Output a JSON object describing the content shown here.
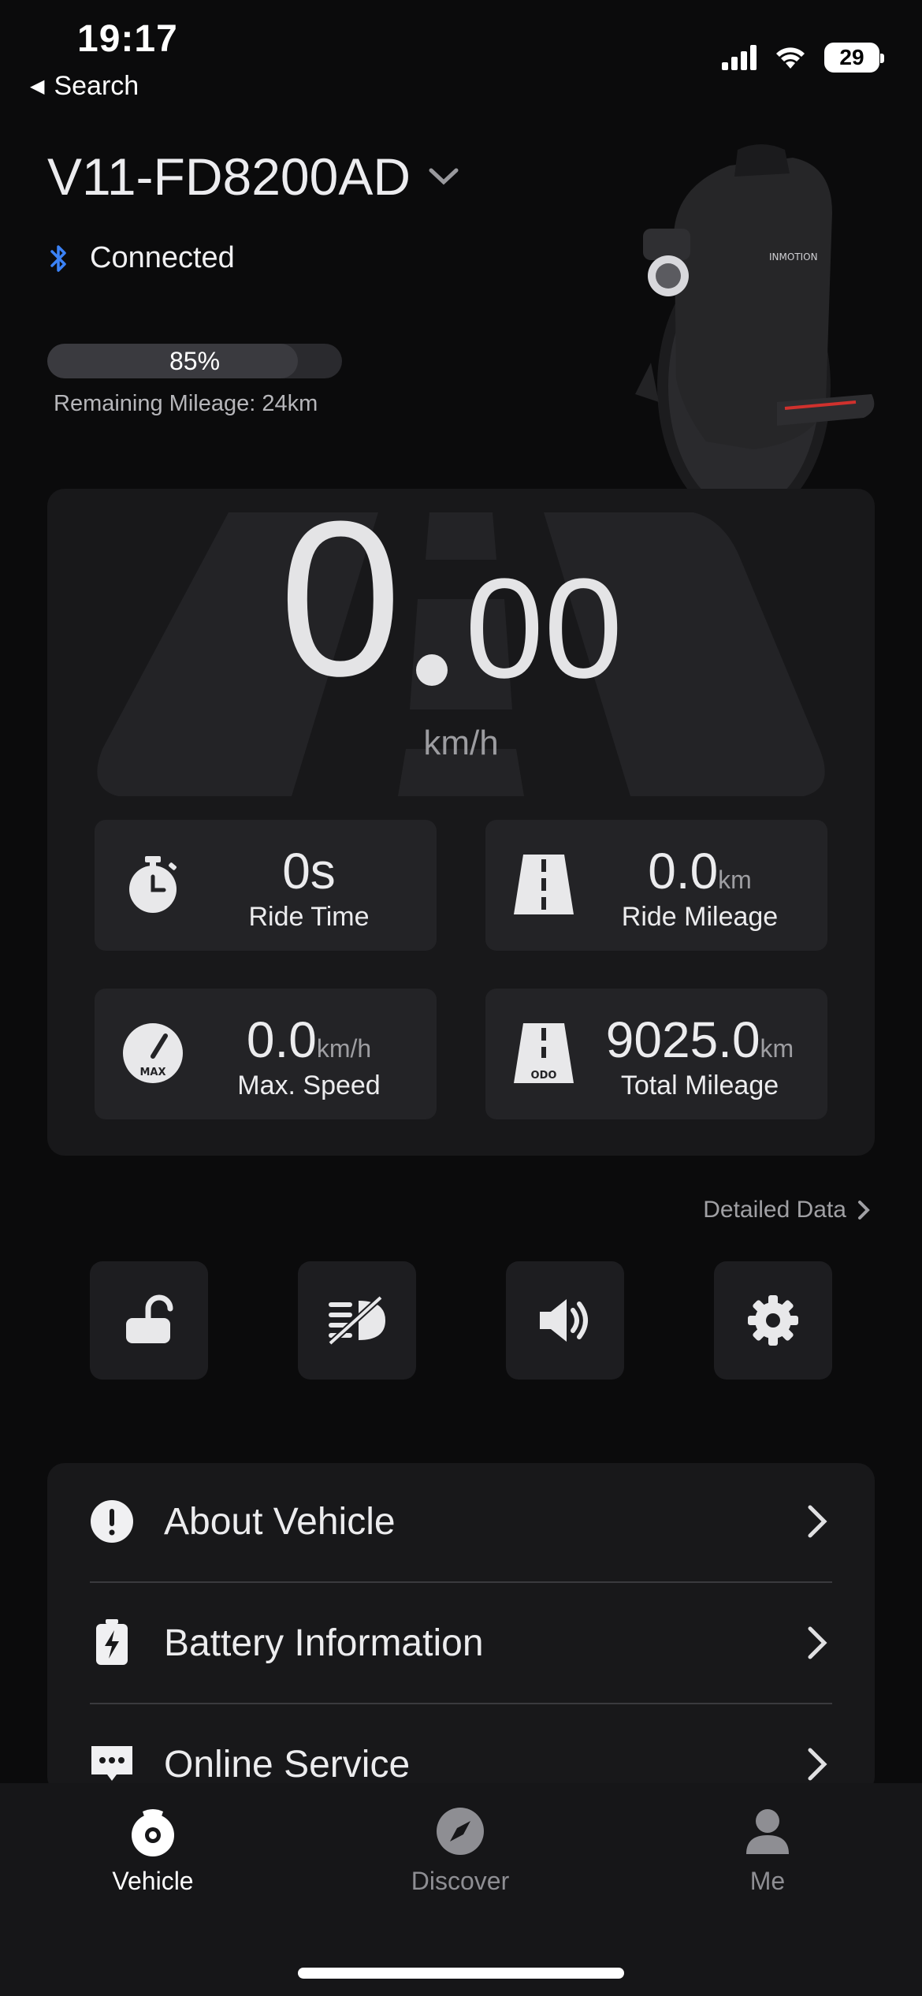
{
  "status": {
    "time": "19:17",
    "back_label": "Search",
    "battery_level": "29"
  },
  "vehicle": {
    "name": "V11-FD8200AD",
    "connection": "Connected",
    "battery_percent": 85,
    "battery_text": "85%",
    "remaining": "Remaining Mileage: 24km"
  },
  "speed": {
    "integer": "0",
    "decimal": "00",
    "unit": "km/h"
  },
  "stats": {
    "ride_time": {
      "value": "0s",
      "unit": "",
      "label": "Ride Time"
    },
    "ride_mileage": {
      "value": "0.0",
      "unit": "km",
      "label": "Ride Mileage"
    },
    "max_speed": {
      "value": "0.0",
      "unit": "km/h",
      "label": "Max. Speed",
      "icon_text": "MAX"
    },
    "total_mileage": {
      "value": "9025.0",
      "unit": "km",
      "label": "Total Mileage",
      "icon_text": "ODO"
    }
  },
  "detailed_data": "Detailed Data",
  "actions": [
    "lock-icon",
    "headlight-off-icon",
    "speaker-icon",
    "gear-icon"
  ],
  "menu": [
    {
      "label": "About Vehicle",
      "icon": "info-icon"
    },
    {
      "label": "Battery Information",
      "icon": "battery-icon"
    },
    {
      "label": "Online Service",
      "icon": "chat-icon"
    }
  ],
  "tabs": [
    {
      "label": "Vehicle",
      "active": true
    },
    {
      "label": "Discover",
      "active": false
    },
    {
      "label": "Me",
      "active": false
    }
  ],
  "colors": {
    "accent_bluetooth": "#3b82f6",
    "active_tab": "#ffffff",
    "inactive_tab": "#8e8e93"
  }
}
